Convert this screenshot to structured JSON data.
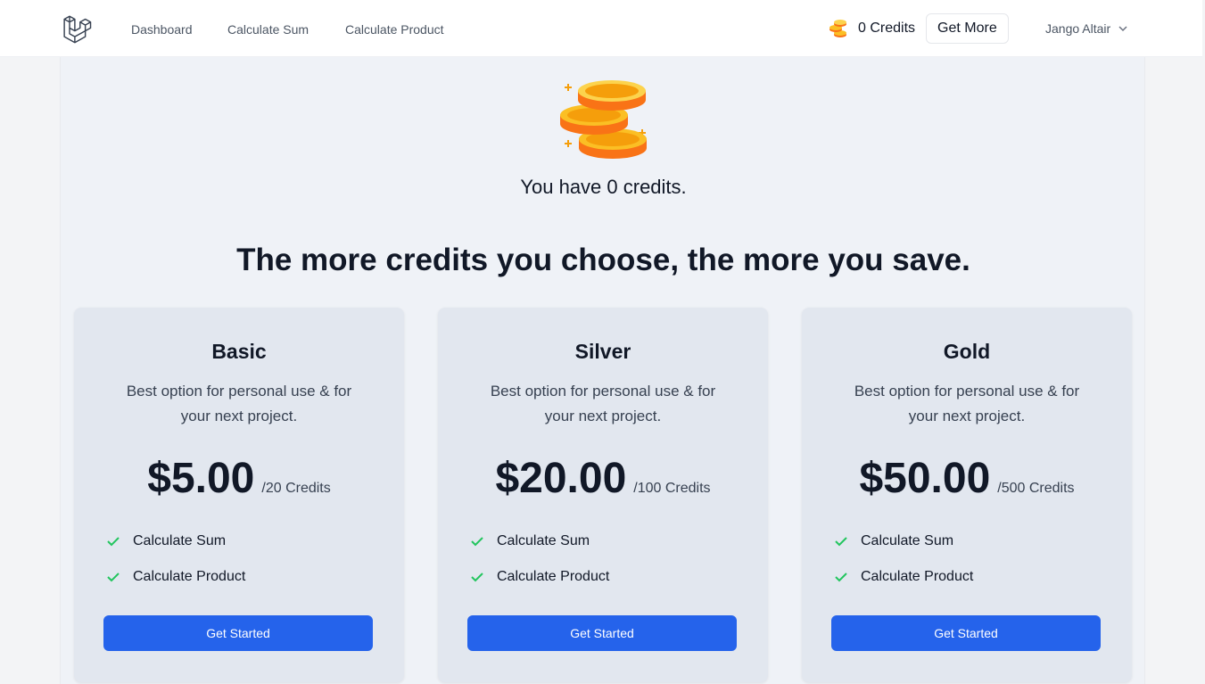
{
  "nav": {
    "logo_icon": "laravel-logo",
    "links": [
      "Dashboard",
      "Calculate Sum",
      "Calculate Product"
    ],
    "credits_icon": "coins-icon",
    "credits_label": "0 Credits",
    "get_more_label": "Get More",
    "user_name": "Jango Altair"
  },
  "hero": {
    "icon": "coins-stack",
    "balance_text": "You have 0 credits.",
    "headline": "The more credits you choose, the more you save."
  },
  "plans": [
    {
      "name": "Basic",
      "description": "Best option for personal use & for your next project.",
      "price": "$5.00",
      "per": "/20 Credits",
      "features": [
        "Calculate Sum",
        "Calculate Product"
      ],
      "cta": "Get Started"
    },
    {
      "name": "Silver",
      "description": "Best option for personal use & for your next project.",
      "price": "$20.00",
      "per": "/100 Credits",
      "features": [
        "Calculate Sum",
        "Calculate Product"
      ],
      "cta": "Get Started"
    },
    {
      "name": "Gold",
      "description": "Best option for personal use & for your next project.",
      "price": "$50.00",
      "per": "/500 Credits",
      "features": [
        "Calculate Sum",
        "Calculate Product"
      ],
      "cta": "Get Started"
    }
  ],
  "colors": {
    "accent": "#2563eb",
    "check": "#22c55e",
    "coin": "#f59e0b"
  }
}
